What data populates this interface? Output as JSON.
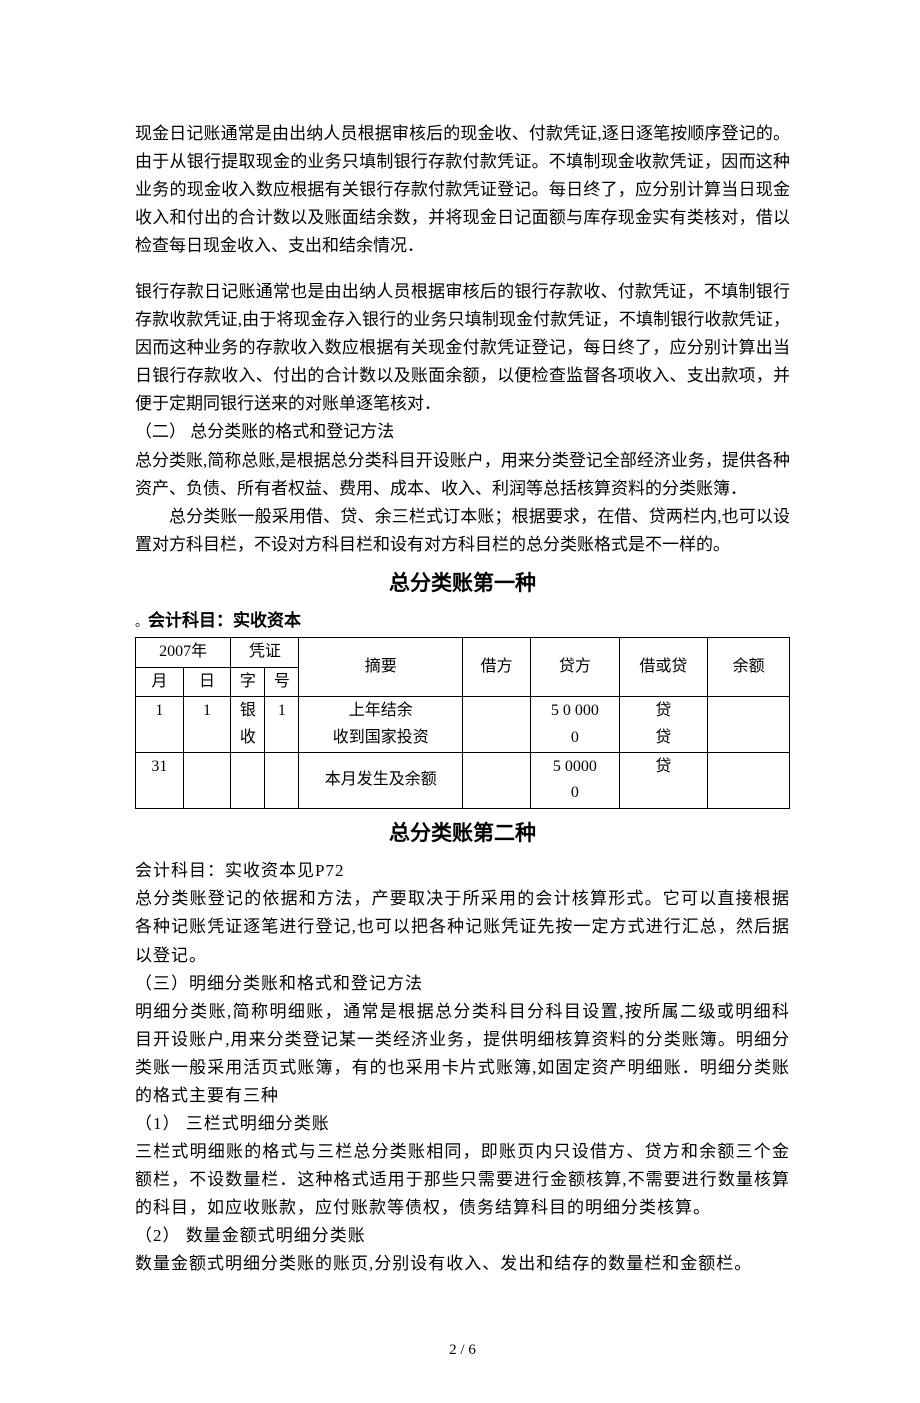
{
  "paragraphs": {
    "p1": "现金日记账通常是由出纳人员根据审核后的现金收、付款凭证,逐日逐笔按顺序登记的。由于从银行提取现金的业务只填制银行存款付款凭证。不填制现金收款凭证，因而这种业务的现金收入数应根据有关银行存款付款凭证登记。每日终了，应分别计算当日现金收入和付出的合计数以及账面结余数，并将现金日记面额与库存现金实有类核对，借以检查每日现金收入、支出和结余情况．",
    "p2": "银行存款日记账通常也是由出纳人员根据审核后的银行存款收、付款凭证，不填制银行存款收款凭证,由于将现金存入银行的业务只填制现金付款凭证，不填制银行收款凭证，因而这种业务的存款收入数应根据有关现金付款凭证登记，每日终了，应分别计算出当日银行存款收入、付出的合计数以及账面余额，以便检查监督各项收入、支出款项，并便于定期同银行送来的对账单逐笔核对．",
    "p3": "（二） 总分类账的格式和登记方法",
    "p4": "总分类账,简称总账,是根据总分类科目开设账户，用来分类登记全部经济业务，提供各种资产、负债、所有者权益、费用、成本、收入、利润等总括核算资料的分类账簿．",
    "p5": "总分类账一般采用借、贷、余三栏式订本账；根据要求，在借、贷两栏内,也可以设置对方科目栏，不设对方科目栏和设有对方科目栏的总分类账格式是不一样的。"
  },
  "heading1": "总分类账第一种",
  "subject1_prefix": "。",
  "subject1": "会计科目：实收资本",
  "table": {
    "header": {
      "year": "2007年",
      "voucher": "凭证",
      "summary": "摘要",
      "debit": "借方",
      "credit": "贷方",
      "dc": "借或贷",
      "balance": "余额",
      "month": "月",
      "day": "日",
      "char": "字",
      "num": "号"
    },
    "rows": [
      {
        "month": "1",
        "day": "1",
        "char": "银收",
        "num": "1",
        "summary": "上年结余\n收到国家投资",
        "debit": "",
        "credit": "5 0 000\n0",
        "dc": "贷\n贷",
        "balance": ""
      },
      {
        "month": "31",
        "day": "",
        "char": "",
        "num": "",
        "summary": "本月发生及余额",
        "debit": "",
        "credit": "5 0000\n0",
        "dc": "贷",
        "balance": ""
      }
    ]
  },
  "heading2": "总分类账第二种",
  "paragraphs2": {
    "p6": "会计科目：实收资本见P72",
    "p7": "总分类账登记的依据和方法，产要取决于所采用的会计核算形式。它可以直接根据各种记账凭证逐笔进行登记,也可以把各种记账凭证先按一定方式进行汇总，然后据以登记。",
    "p8": "（三）明细分类账和格式和登记方法",
    "p9": "明细分类账,简称明细账，通常是根据总分类科目分科目设置,按所属二级或明细科目开设账户,用来分类登记某一类经济业务，提供明细核算资料的分类账簿。明细分类账一般采用活页式账簿，有的也采用卡片式账簿,如固定资产明细账．明细分类账的格式主要有三种",
    "p10": "（1） 三栏式明细分类账",
    "p11": "三栏式明细账的格式与三栏总分类账相同，即账页内只设借方、贷方和余额三个金额栏，不设数量栏．这种格式适用于那些只需要进行金额核算,不需要进行数量核算的科目，如应收账款，应付账款等债权，债务结算科目的明细分类核算。",
    "p12": "（2） 数量金额式明细分类账",
    "p13": "数量金额式明细分类账的账页,分别设有收入、发出和结存的数量栏和金额栏。"
  },
  "pagenum": "2 / 6"
}
